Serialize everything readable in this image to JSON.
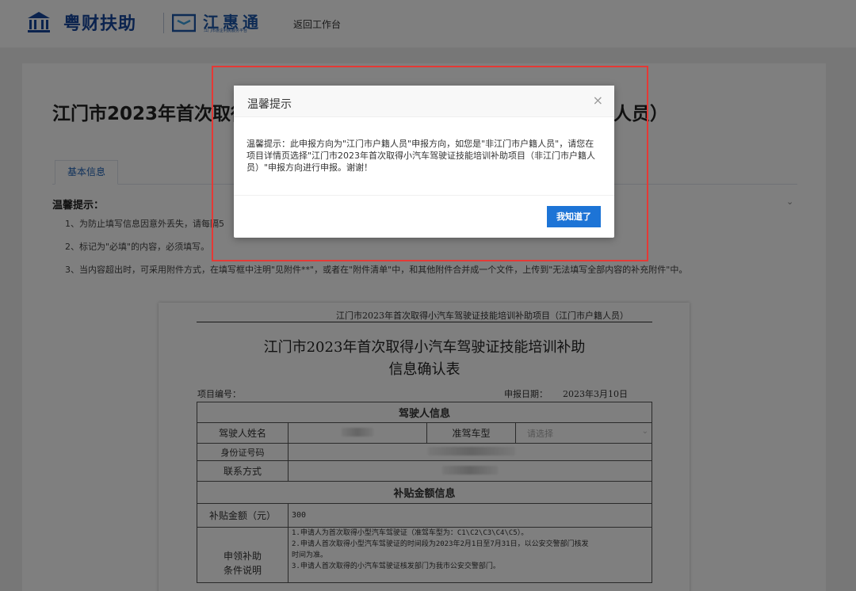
{
  "header": {
    "brand": "粤财扶助",
    "jht_title": "江惠通",
    "jht_subtitle": "江门市惠企利民服务平台",
    "back_link": "返回工作台"
  },
  "page": {
    "title": "江门市2023年首次取得小汽车驾驶证技能培训补助项目（江门市户籍人员）",
    "tab_basic": "基本信息",
    "tips_heading": "温馨提示：",
    "tips": [
      "1、为防止填写信息因意外丢失，请每隔5",
      "2、标记为\"必填\"的内容，必须填写。",
      "3、当内容超出时，可采用附件方式，在填写框中注明\"见附件**\"，或者在\"附件清单\"中，和其他附件合并成一个文件，上传到\"无法填写全部内容的补充附件\"中。"
    ]
  },
  "document": {
    "header_note": "江门市2023年首次取得小汽车驾驶证技能培训补助项目（江门市户籍人员）",
    "title_line1": "江门市2023年首次取得小汽车驾驶证技能培训补助",
    "title_line2": "信息确认表",
    "project_no_label": "项目编号：",
    "date_label": "申报日期：",
    "date_value": "2023年3月10日",
    "section_driver": "驾驶人信息",
    "driver_name_label": "驾驶人姓名",
    "vehicle_type_label": "准驾车型",
    "vehicle_type_placeholder": "请选择",
    "id_label": "身份证号码",
    "contact_label": "联系方式",
    "section_subsidy": "补贴金额信息",
    "subsidy_label": "补贴金额（元）",
    "subsidy_value": "300",
    "conditions_label_1": "申领补助",
    "conditions_label_2": "条件说明",
    "conditions": [
      "1.申请人为首次取得小型汽车驾驶证（准驾车型为：C1\\C2\\C3\\C4\\C5）。",
      "2.申请人首次取得小型汽车驾驶证的时间段为2023年2月1日至7月31日，以公安交警部门核发",
      "时间为准。",
      "3.申请人首次取得的小汽车驾驶证核发部门为我市公安交警部门。"
    ]
  },
  "modal": {
    "title": "温馨提示",
    "close_symbol": "×",
    "body": "温馨提示：此申报方向为\"江门市户籍人员\"申报方向，如您是\"非江门市户籍人员\"，请您在项目详情页选择\"江门市2023年首次取得小汽车驾驶证技能培训补助项目（非江门市户籍人员）\"申报方向进行申报。谢谢！",
    "ok_button": "我知道了"
  },
  "colors": {
    "brand_blue": "#16469d",
    "button_blue": "#1d74d6",
    "highlight_red": "#e53935"
  },
  "icons": {
    "brand_logo": "building-icon",
    "jht_logo": "jht-logo-icon",
    "close": "close-icon",
    "chevron": "chevron-down-icon"
  }
}
